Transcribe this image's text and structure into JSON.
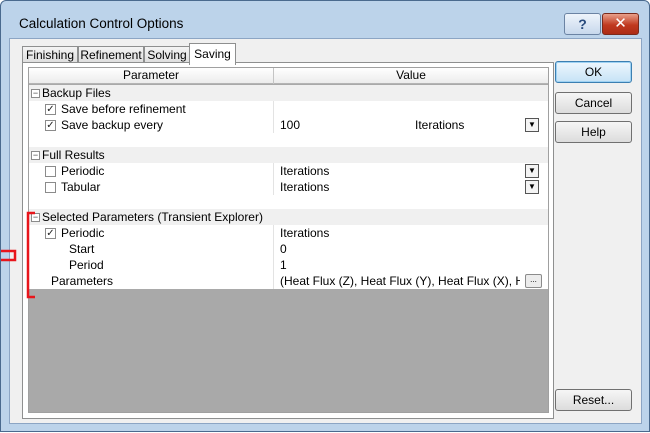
{
  "window": {
    "title": "Calculation Control Options",
    "help_label": "?",
    "close_label": "✕"
  },
  "tabs": [
    {
      "label": "Finishing"
    },
    {
      "label": "Refinement"
    },
    {
      "label": "Solving"
    },
    {
      "label": "Saving",
      "active": true
    }
  ],
  "grid": {
    "col_parameter": "Parameter",
    "col_value": "Value",
    "sections": {
      "backup": {
        "label": "Backup Files",
        "save_before": {
          "label": "Save before refinement",
          "checked": true
        },
        "save_every": {
          "label": "Save backup every",
          "checked": true,
          "value": "100",
          "unit": "Iterations"
        }
      },
      "full": {
        "label": "Full Results",
        "periodic": {
          "label": "Periodic",
          "checked": false,
          "value": "Iterations"
        },
        "tabular": {
          "label": "Tabular",
          "checked": false,
          "value": "Iterations"
        }
      },
      "selected": {
        "label": "Selected Parameters (Transient Explorer)",
        "periodic": {
          "label": "Periodic",
          "checked": true,
          "value": "Iterations"
        },
        "start": {
          "label": "Start",
          "value": "0"
        },
        "period": {
          "label": "Period",
          "value": "1"
        },
        "parameters": {
          "label": "Parameters",
          "value": "(Heat Flux (Z), Heat Flux (Y), Heat Flux (X), H..."
        }
      }
    }
  },
  "buttons": {
    "ok": "OK",
    "cancel": "Cancel",
    "help": "Help",
    "reset": "Reset..."
  },
  "icons": {
    "collapse": "⊟",
    "check": "✓",
    "dropdown": "▼",
    "ellipsis": "..."
  },
  "colors": {
    "annotation": "#e8151b",
    "window_frame": "#bcd3ea",
    "grid_empty": "#a9a9a9"
  }
}
